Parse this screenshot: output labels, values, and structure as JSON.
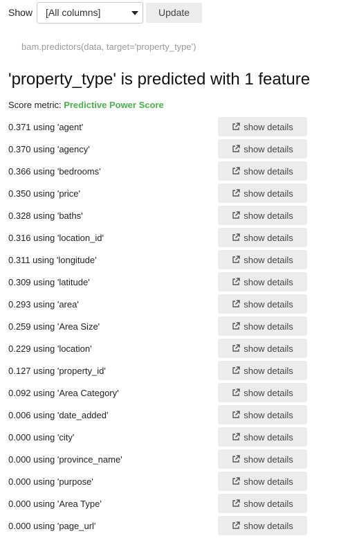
{
  "toolbar": {
    "show_label": "Show",
    "columns_select_value": "[All columns]",
    "update_label": "Update"
  },
  "code_snippet": "bam.predictors(data, target='property_type')",
  "heading": "'property_type' is predicted with 1 feature",
  "score_metric": {
    "label": "Score metric:",
    "value": "Predictive Power Score",
    "value_color": "#4caf50"
  },
  "detail_button_label": "show details",
  "detail_button_icon": "external-link-icon",
  "predictors": [
    {
      "label": "0.371 using 'agent'"
    },
    {
      "label": "0.370 using 'agency'"
    },
    {
      "label": "0.366 using 'bedrooms'"
    },
    {
      "label": "0.350 using 'price'"
    },
    {
      "label": "0.328 using 'baths'"
    },
    {
      "label": "0.316 using 'location_id'"
    },
    {
      "label": "0.311 using 'longitude'"
    },
    {
      "label": "0.309 using 'latitude'"
    },
    {
      "label": "0.293 using 'area'"
    },
    {
      "label": "0.259 using 'Area Size'"
    },
    {
      "label": "0.229 using 'location'"
    },
    {
      "label": "0.127 using 'property_id'"
    },
    {
      "label": "0.092 using 'Area Category'"
    },
    {
      "label": "0.006 using 'date_added'"
    },
    {
      "label": "0.000 using 'city'"
    },
    {
      "label": "0.000 using 'province_name'"
    },
    {
      "label": "0.000 using 'purpose'"
    },
    {
      "label": "0.000 using 'Area Type'"
    },
    {
      "label": "0.000 using 'page_url'"
    }
  ]
}
